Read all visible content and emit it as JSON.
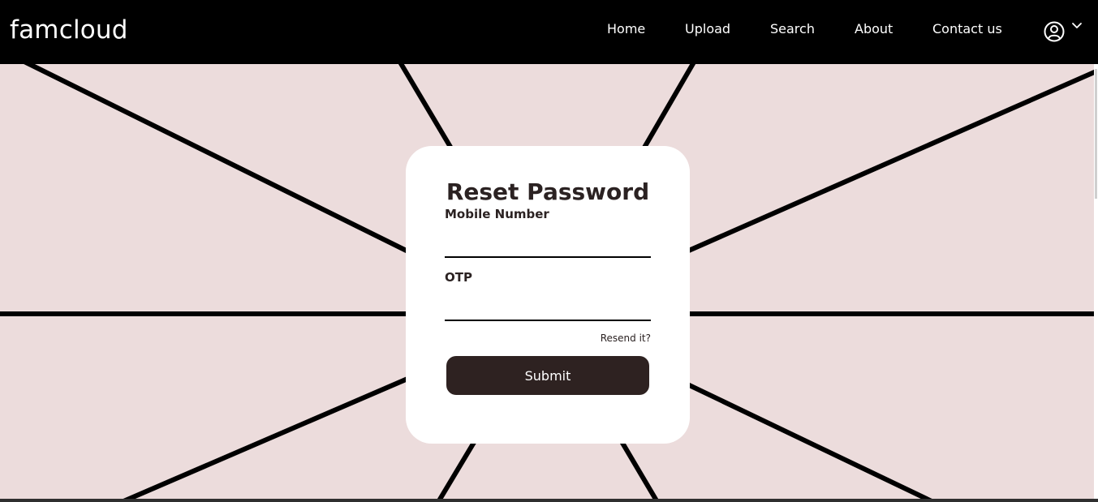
{
  "brand": {
    "name": "famcloud"
  },
  "nav": {
    "home": "Home",
    "upload": "Upload",
    "search": "Search",
    "about": "About",
    "contact": "Contact us"
  },
  "profile": {
    "icon": "user-circle-icon",
    "dropdown_icon": "chevron-down-icon"
  },
  "form": {
    "title": "Reset Password",
    "mobile_label": "Mobile Number",
    "mobile_value": "",
    "mobile_placeholder": "",
    "otp_label": "OTP",
    "otp_value": "",
    "otp_placeholder": "",
    "resend_label": "Resend it?",
    "submit_label": "Submit"
  },
  "colors": {
    "navbar": "#000000",
    "page_background": "#ecdcdc",
    "card_background": "#ffffff",
    "primary_text": "#2b2222",
    "button_background": "#2e2221"
  }
}
